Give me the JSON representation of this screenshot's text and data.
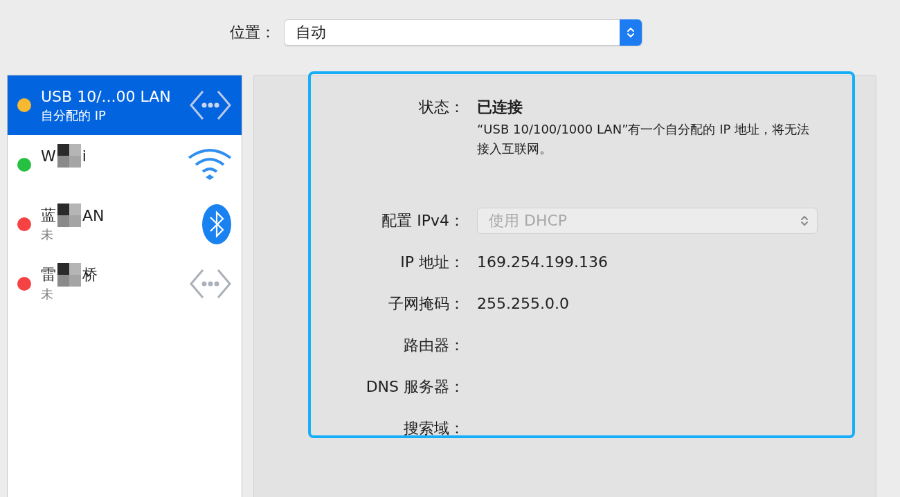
{
  "location": {
    "label": "位置：",
    "value": "自动"
  },
  "services": [
    {
      "name": "USB 10/...00 LAN",
      "status": "自分配的 IP",
      "color": "#f8b932",
      "selected": true,
      "redacted": false
    },
    {
      "name": "W",
      "name_tail": "i",
      "color": "#27c142",
      "selected": false,
      "redacted": true
    },
    {
      "name": "蓝",
      "name_tail": "AN",
      "status": "未",
      "color": "#f54343",
      "selected": false,
      "redacted": true
    },
    {
      "name": "雷",
      "name_tail": "桥",
      "status": "未",
      "color": "#f54343",
      "selected": false,
      "redacted": true
    }
  ],
  "detail": {
    "status": {
      "label": "状态：",
      "value": "已连接",
      "description": "“USB 10/100/1000 LAN”有一个自分配的 IP 地址，将无法接入互联网。"
    },
    "fields": [
      {
        "label": "配置 IPv4：",
        "kind": "select",
        "value": "使用 DHCP",
        "disabled": true
      },
      {
        "label": "IP 地址：",
        "kind": "text",
        "value": "169.254.199.136"
      },
      {
        "label": "子网掩码：",
        "kind": "text",
        "value": "255.255.0.0"
      },
      {
        "label": "路由器：",
        "kind": "text"
      },
      {
        "label": "DNS 服务器：",
        "kind": "text"
      },
      {
        "label": "搜索域：",
        "kind": "text"
      }
    ]
  }
}
